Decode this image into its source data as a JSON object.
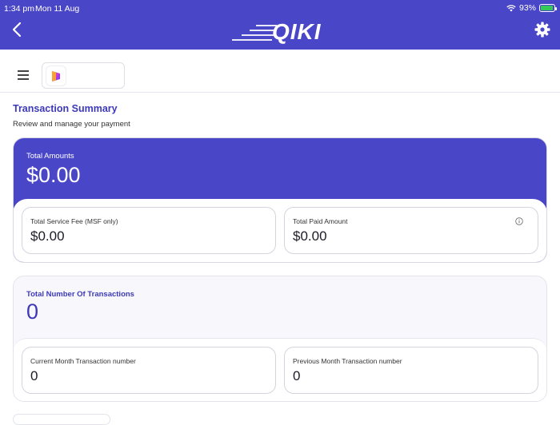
{
  "status_bar": {
    "time": "1:34 pm",
    "date": "Mon 11 Aug",
    "battery": "93%"
  },
  "header": {
    "logo_text": "QIKI",
    "accent": "#4a46c8"
  },
  "page": {
    "title": "Transaction Summary",
    "subtitle": "Review and manage your payment"
  },
  "amounts": {
    "label": "Total Amounts",
    "value": "$0.00",
    "service_fee_label": "Total Service Fee (MSF only)",
    "service_fee_value": "$0.00",
    "paid_label": "Total Paid Amount",
    "paid_value": "$0.00"
  },
  "transactions": {
    "label": "Total Number Of Transactions",
    "value": "0",
    "current_label": "Current Month Transaction number",
    "current_value": "0",
    "previous_label": "Previous Month Transaction number",
    "previous_value": "0"
  },
  "icons": {
    "back": "chevron-left-icon",
    "settings": "gear-icon",
    "menu": "hamburger-icon",
    "info": "info-icon",
    "wifi": "wifi-icon",
    "battery": "battery-icon"
  }
}
